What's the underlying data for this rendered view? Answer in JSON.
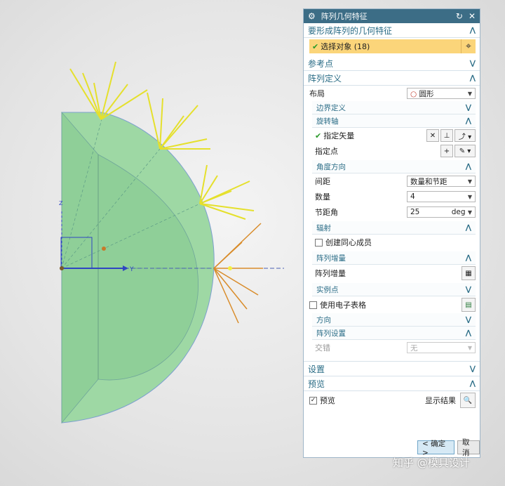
{
  "dialog": {
    "title": "阵列几何特征",
    "icons": [
      "gear-icon",
      "reset-icon",
      "close-icon"
    ]
  },
  "sections": {
    "geometry": {
      "label": "要形成阵列的几何特征",
      "select_label": "选择对象 (18)"
    },
    "reference_point": {
      "label": "参考点"
    },
    "array_def": {
      "label": "阵列定义",
      "layout_label": "布局",
      "layout_value": "圆形",
      "boundary": "边界定义",
      "rotation_axis": {
        "label": "旋转轴",
        "vector_label": "指定矢量",
        "point_label": "指定点"
      },
      "angle_dir": {
        "label": "角度方向",
        "spacing_label": "间距",
        "spacing_value": "数量和节距",
        "count_label": "数量",
        "count_value": "4",
        "pitch_label": "节距角",
        "pitch_value": "25",
        "pitch_unit": "deg"
      },
      "radiate": {
        "label": "辐射",
        "concentric_label": "创建同心成员"
      },
      "increment": {
        "label": "阵列增量",
        "row_label": "阵列增量"
      },
      "instance": {
        "label": "实例点",
        "spreadsheet_label": "使用电子表格"
      },
      "direction": {
        "label": "方向"
      },
      "settings": {
        "label": "阵列设置",
        "stagger_label": "交错",
        "stagger_value": "无"
      }
    },
    "settings": {
      "label": "设置"
    },
    "preview": {
      "label": "预览",
      "checkbox_label": "预览",
      "show_result_label": "显示结果"
    }
  },
  "buttons": {
    "ok": "< 确定 >",
    "cancel": "取消"
  },
  "viewport": {
    "axis_y_label": "Y",
    "axis_z_label": "Z"
  },
  "watermark": "知乎 @模具设计",
  "colors": {
    "title_bar": "#3c6d86",
    "section_text": "#2a6c86",
    "selection_bg": "#fbd57a",
    "solid_fill": "#8fd29a"
  }
}
